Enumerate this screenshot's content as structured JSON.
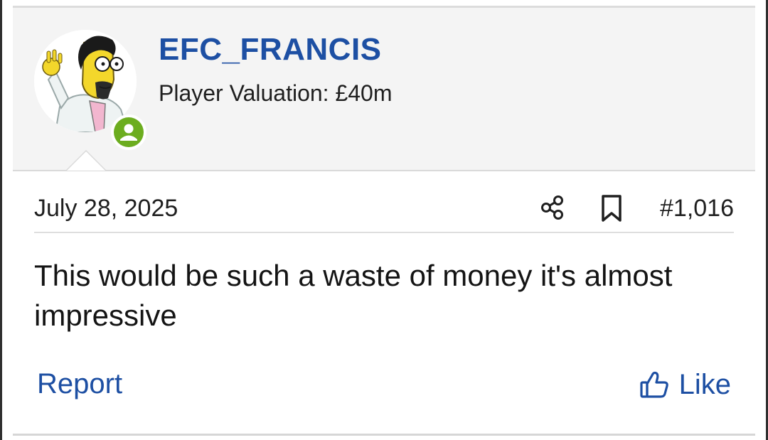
{
  "user": {
    "name": "EFC_FRANCIS",
    "title": "Player Valuation: £40m",
    "status": "online"
  },
  "post": {
    "date": "July 28, 2025",
    "number": "#1,016",
    "body": "This would be such a waste of money it's almost impressive"
  },
  "actions": {
    "report_label": "Report",
    "like_label": "Like"
  },
  "icons": {
    "share": "share-icon",
    "bookmark": "bookmark-icon",
    "like": "thumbs-up-icon",
    "online": "user-online-icon"
  },
  "colors": {
    "link": "#1d4fa3",
    "online": "#6cad1f",
    "header_bg": "#f4f4f4"
  }
}
